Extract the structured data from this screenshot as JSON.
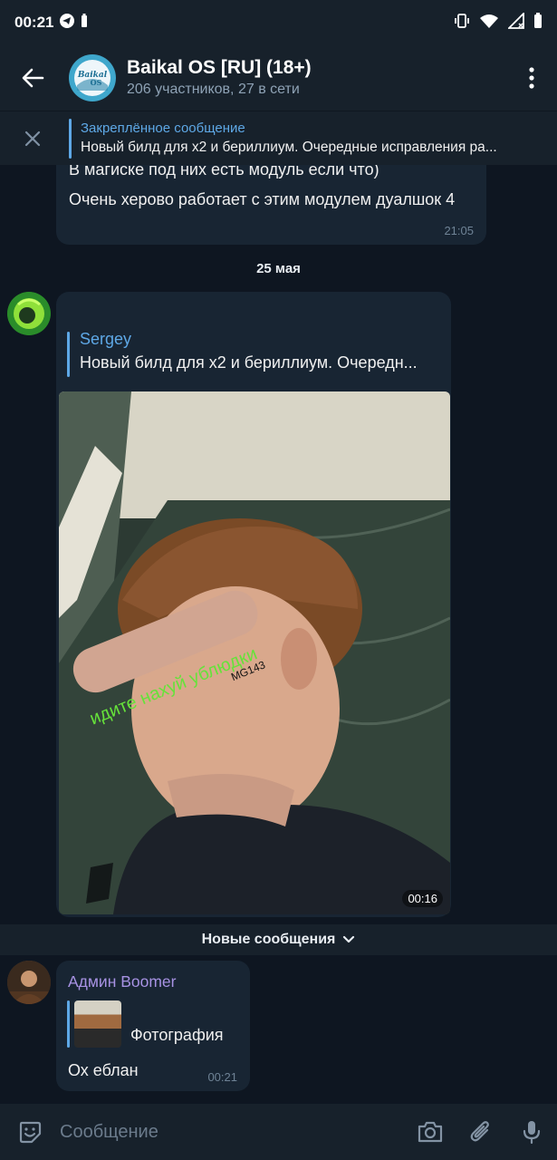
{
  "status_bar": {
    "time": "00:21"
  },
  "header": {
    "title": "Baikal OS [RU] (18+)",
    "subtitle": "206 участников, 27 в сети",
    "avatar_logo": "Baikal OS"
  },
  "pinned": {
    "title": "Закреплённое сообщение",
    "message": "Новый билд для x2 и бериллиум.  Очередные исправления ра..."
  },
  "messages": {
    "first": {
      "line_partial": "В магиске под них есть модуль если что)",
      "text": "Очень херово работает с этим модулем дуалшок 4",
      "time": "21:05"
    },
    "date_separator": "25 мая",
    "second": {
      "reply_name": "Sergey",
      "reply_text": "Новый билд для x2 и бериллиум.  Очередн...",
      "photo_caption_overlay": "идите нахуй ублюдки",
      "photo_watermark": "MG143",
      "time": "00:16"
    },
    "new_messages_label": "Новые сообщения",
    "third": {
      "sender": "Админ Boomer",
      "reply_label": "Фотография",
      "text": "Ох еблан",
      "time": "00:21"
    }
  },
  "input": {
    "placeholder": "Сообщение"
  },
  "colors": {
    "background": "#0e1621",
    "panel": "#17212b",
    "bubble": "#182533",
    "accent": "#5ea8e6",
    "admin_name": "#a792e3"
  }
}
